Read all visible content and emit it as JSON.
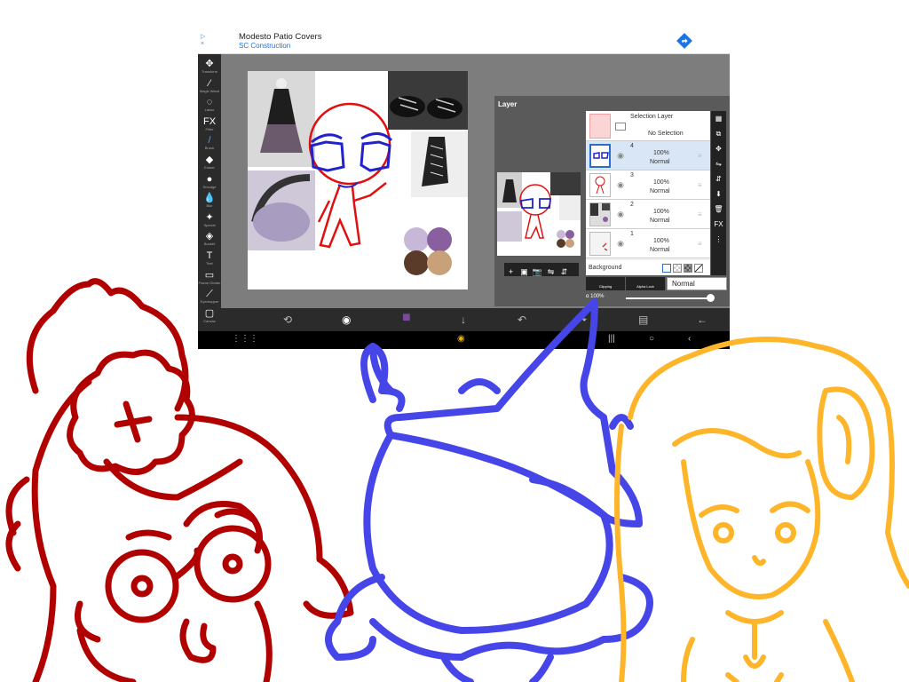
{
  "ad": {
    "mark": "▷\n×",
    "title": "Modesto Patio Covers",
    "subtitle": "SC Construction"
  },
  "tools": [
    {
      "label": "Transform",
      "icon": "✥"
    },
    {
      "label": "Magic Wand",
      "icon": "⁄"
    },
    {
      "label": "Lasso",
      "icon": "◌"
    },
    {
      "label": "Filter",
      "icon": "FX"
    },
    {
      "label": "Brush",
      "icon": "/"
    },
    {
      "label": "Eraser",
      "icon": "◆"
    },
    {
      "label": "Smudge",
      "icon": "●"
    },
    {
      "label": "Blur",
      "icon": "💧"
    },
    {
      "label": "Special",
      "icon": "✦"
    },
    {
      "label": "Bucket",
      "icon": "◈"
    },
    {
      "label": "Text",
      "icon": "T"
    },
    {
      "label": "Frame Divider",
      "icon": "▭"
    },
    {
      "label": "Eyedropper",
      "icon": "⟋"
    },
    {
      "label": "Canvas",
      "icon": "▢"
    }
  ],
  "layer_panel": {
    "title": "Layer",
    "selection_layer": "Selection Layer",
    "no_selection": "No Selection",
    "layers": [
      {
        "num": "4",
        "opacity": "100%",
        "mode": "Normal"
      },
      {
        "num": "3",
        "opacity": "100%",
        "mode": "Normal"
      },
      {
        "num": "2",
        "opacity": "100%",
        "mode": "Normal"
      },
      {
        "num": "1",
        "opacity": "100%",
        "mode": "Normal"
      }
    ],
    "background_label": "Background",
    "clipping_label": "Clipping",
    "alpha_lock_label": "Alpha Lock",
    "blend_mode": "Normal",
    "alpha_label": "α 100%",
    "opacity_level": 1.0,
    "side_tools": [
      "▦",
      "⧉",
      "✥",
      "⇋",
      "⇵",
      "⬇",
      "🗑",
      "FX",
      "⋮"
    ],
    "preview_tools": [
      "+",
      "▣",
      "📷",
      "⇋",
      "⇵"
    ]
  },
  "bottom_bar": {
    "icons": [
      "⟲",
      "◉",
      "■",
      "↓",
      "↶",
      "↷",
      "▤",
      "←"
    ]
  },
  "navbar": {
    "icons": [
      "⋮⋮⋮",
      "◉",
      "|||",
      "○",
      "‹"
    ]
  },
  "colors": {
    "red_character": "#b00000",
    "blue_character": "#4646e8",
    "yellow_character": "#ffb52a",
    "current_color": "#7a4a9a",
    "palette": [
      "#c7b8d8",
      "#8a5fa0",
      "#5a3a28",
      "#c8a07a"
    ]
  },
  "characters": {
    "left": {
      "name": "red-glasses-girl"
    },
    "center": {
      "name": "blue-witch-hat"
    },
    "right": {
      "name": "yellow-headphone-girl"
    }
  }
}
